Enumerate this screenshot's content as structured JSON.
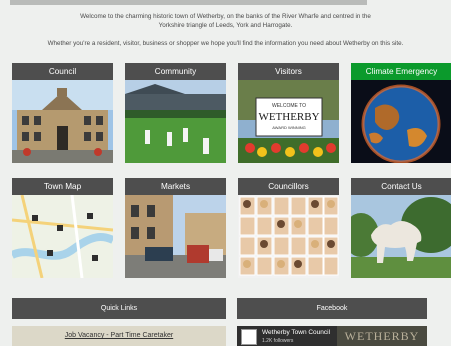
{
  "intro": {
    "line1": "Welcome to the charming historic town of Wetherby, on the banks of the River Wharfe and centred in the",
    "line2": "Yorkshire triangle of Leeds, York and Harrogate.",
    "line3": "Whether you're a resident, visitor, business or shopper we hope you'll find the information you need about Wetherby on this site."
  },
  "tiles": [
    {
      "label": "Council"
    },
    {
      "label": "Community"
    },
    {
      "label": "Visitors"
    },
    {
      "label": "Climate Emergency"
    },
    {
      "label": "Town Map"
    },
    {
      "label": "Markets"
    },
    {
      "label": "Councillors"
    },
    {
      "label": "Contact Us"
    }
  ],
  "sign": {
    "line1": "WELCOME TO",
    "line2": "WETHERBY",
    "line3": "AWARD WINNING"
  },
  "quick_links": {
    "title": "Quick Links",
    "first_link": "Job Vacancy - Part Time Caretaker"
  },
  "facebook": {
    "title": "Facebook",
    "page_name": "Wetherby Town Council",
    "sub_text": "1.2K followers",
    "banner_text": "WETHERBY"
  },
  "colors": {
    "tile_header": "#4e4e4e",
    "climate_header": "#0b9a2c",
    "background": "#eef0ee"
  }
}
